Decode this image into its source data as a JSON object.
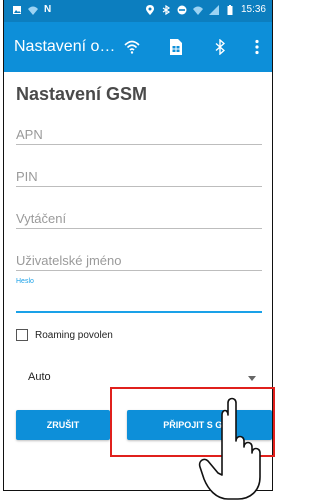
{
  "status_bar": {
    "time": "15:36",
    "left_icons": [
      "photo-icon",
      "wifi-icon",
      "n-icon"
    ],
    "right_icons": [
      "location-icon",
      "bluetooth-icon",
      "minus-circle-icon",
      "wifi-icon",
      "no-signal-icon",
      "battery-icon"
    ]
  },
  "toolbar": {
    "title": "Nastavení o…",
    "icons": [
      "wifi-icon",
      "sim-card-icon",
      "bluetooth-icon",
      "more-vert-icon"
    ]
  },
  "form": {
    "heading": "Nastavení GSM",
    "apn_placeholder": "APN",
    "pin_placeholder": "PIN",
    "dial_placeholder": "Vytáčení",
    "username_placeholder": "Uživatelské jméno",
    "password_label": "Heslo",
    "roaming_label": "Roaming povolen",
    "roaming_checked": false,
    "network_mode": "Auto"
  },
  "buttons": {
    "cancel": "ZRUŠIT",
    "connect": "PŘIPOJIT S GSM"
  },
  "colors": {
    "toolbar": "#0d8fd9",
    "status_bar": "#0c7ebf",
    "accent": "#1aa1e8",
    "highlight": "#e0201c"
  }
}
